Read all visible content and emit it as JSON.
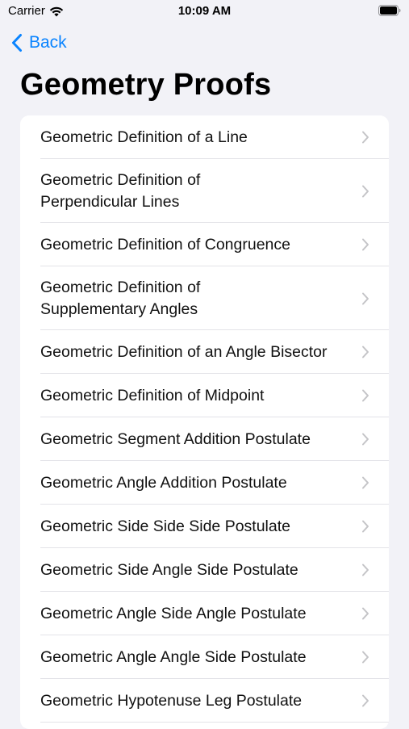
{
  "status_bar": {
    "carrier": "Carrier",
    "time": "10:09 AM",
    "wifi_icon": "wifi-icon",
    "battery_icon": "battery-icon"
  },
  "nav": {
    "back_label": "Back",
    "back_icon": "chevron-left-icon"
  },
  "page": {
    "title": "Geometry Proofs"
  },
  "colors": {
    "accent": "#0a84ff",
    "background": "#f2f2f7",
    "card": "#ffffff",
    "chevron": "#c4c4c7"
  },
  "list": {
    "items": [
      {
        "label": "Geometric Definition of a Line"
      },
      {
        "label": "Geometric Definition of Perpendicular Lines"
      },
      {
        "label": "Geometric Definition of Congruence"
      },
      {
        "label": "Geometric Definition of Supplementary Angles"
      },
      {
        "label": "Geometric Definition of an Angle Bisector"
      },
      {
        "label": "Geometric Definition of Midpoint"
      },
      {
        "label": "Geometric Segment Addition Postulate"
      },
      {
        "label": "Geometric Angle Addition Postulate"
      },
      {
        "label": "Geometric Side Side Side Postulate"
      },
      {
        "label": "Geometric Side Angle Side Postulate"
      },
      {
        "label": "Geometric Angle Side Angle Postulate"
      },
      {
        "label": "Geometric Angle Angle Side Postulate"
      },
      {
        "label": "Geometric Hypotenuse Leg Postulate"
      }
    ]
  }
}
